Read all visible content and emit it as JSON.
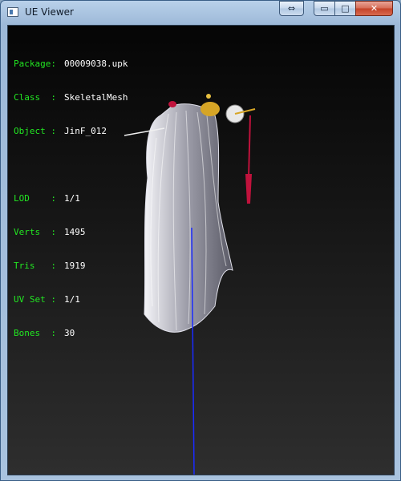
{
  "window": {
    "title": "UE Viewer",
    "buttons": {
      "restore": "⇔",
      "minimize": "▭",
      "maximize": "□",
      "close": "✕"
    }
  },
  "info": {
    "package": {
      "label": "Package:",
      "value": "00009038.upk"
    },
    "class": {
      "label": "Class  :",
      "value": "SkeletalMesh"
    },
    "object": {
      "label": "Object :",
      "value": "JinF_012"
    },
    "lod": {
      "label": "LOD    :",
      "value": "1/1"
    },
    "verts": {
      "label": "Verts  :",
      "value": "1495"
    },
    "tris": {
      "label": "Tris   :",
      "value": "1919"
    },
    "uvset": {
      "label": "UV Set :",
      "value": "1/1"
    },
    "bones": {
      "label": "Bones  :",
      "value": "30"
    }
  },
  "colors": {
    "label_green": "#22e622",
    "value_white": "#ffffff",
    "axis_blue": "#1a2bff",
    "hair_grey": "#c8c8d0",
    "tassel_red": "#c0123c"
  },
  "icons": [
    "app-window-icon",
    "restore-icon",
    "minimize-icon",
    "maximize-icon",
    "close-icon"
  ]
}
